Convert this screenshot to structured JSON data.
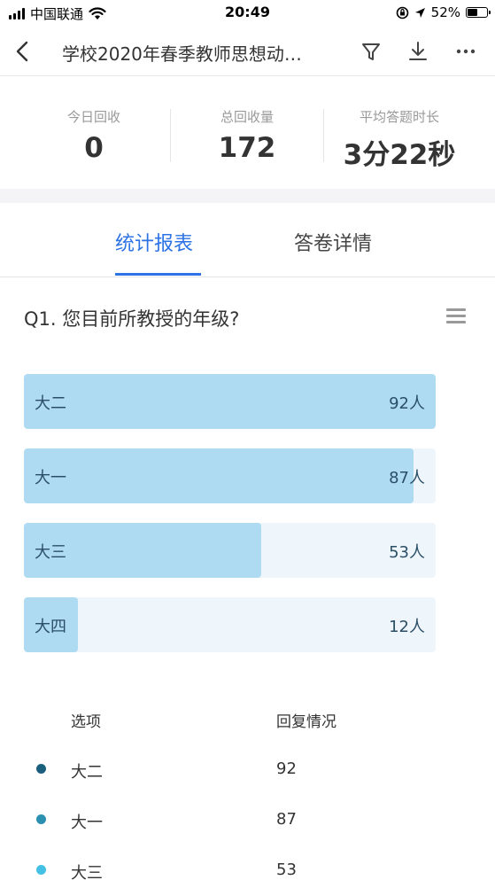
{
  "status_bar": {
    "carrier": "中国联通",
    "time": "20:49",
    "battery_percent": "52%",
    "battery_level": 0.52,
    "icons": [
      "signal-icon",
      "wifi-icon",
      "orientation-lock-icon",
      "location-arrow-icon",
      "battery-icon"
    ]
  },
  "nav": {
    "title": "学校2020年春季教师思想动…",
    "icons": [
      "back-chevron-icon",
      "filter-icon",
      "download-icon",
      "more-icon"
    ]
  },
  "stats": [
    {
      "label": "今日回收",
      "value": "0"
    },
    {
      "label": "总回收量",
      "value": "172"
    },
    {
      "label": "平均答题时长",
      "value": "3分22秒"
    }
  ],
  "tabs": [
    {
      "label": "统计报表",
      "active": true
    },
    {
      "label": "答卷详情",
      "active": false
    }
  ],
  "question": {
    "title": "Q1. 您目前所教授的年级?"
  },
  "chart_data": {
    "type": "bar",
    "orientation": "horizontal",
    "categories": [
      "大二",
      "大一",
      "大三",
      "大四"
    ],
    "values": [
      92,
      87,
      53,
      12
    ],
    "value_labels": [
      "92人",
      "87人",
      "53人",
      "12人"
    ],
    "max": 92,
    "bar_color": "#aedaf2",
    "track_color": "#eef5fb"
  },
  "table": {
    "headers": {
      "option": "选项",
      "response": "回复情况"
    },
    "rows": [
      {
        "name": "大二",
        "value": "92",
        "color": "#1b5f7e"
      },
      {
        "name": "大一",
        "value": "87",
        "color": "#2b8fb2"
      },
      {
        "name": "大三",
        "value": "53",
        "color": "#43c0e4"
      }
    ]
  },
  "colors": {
    "accent": "#2d73e6",
    "divider": "#e5e5e5"
  }
}
